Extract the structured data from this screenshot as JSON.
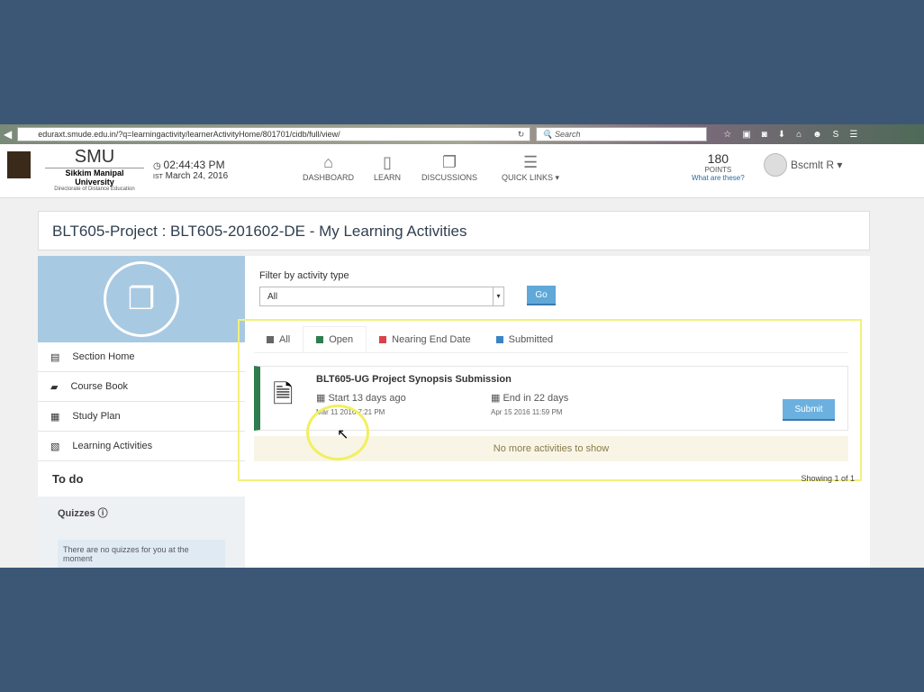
{
  "browser": {
    "url": "eduraxt.smude.edu.in/?q=learningactivity/learnerActivityHome/801701/cidb/full/view/",
    "search_placeholder": "Search"
  },
  "header": {
    "logo_title": "SMU",
    "logo_subtitle": "Sikkim Manipal University",
    "logo_tagline": "Directorate of Distance Education",
    "time": "02:44:43 PM",
    "tz": "IST",
    "date": "March 24, 2016",
    "nav": [
      {
        "label": "DASHBOARD",
        "icon": "home-icon"
      },
      {
        "label": "LEARN",
        "icon": "document-icon"
      },
      {
        "label": "DISCUSSIONS",
        "icon": "chat-icon"
      },
      {
        "label": "QUICK LINKS ▾",
        "icon": "list-icon"
      }
    ],
    "points": "180",
    "points_label": "POINTS",
    "points_link": "What are these?",
    "user": "Bscmlt R ▾"
  },
  "page_title": "BLT605-Project : BLT605-201602-DE - My Learning Activities",
  "sidebar": {
    "items": [
      {
        "label": "Section Home",
        "icon": "section-home-icon"
      },
      {
        "label": "Course Book",
        "icon": "book-icon"
      },
      {
        "label": "Study Plan",
        "icon": "study-plan-icon"
      },
      {
        "label": "Learning Activities",
        "icon": "activities-icon"
      }
    ],
    "todo": "To do",
    "quizzes": "Quizzes",
    "quiz_msg": "There are no quizzes for you at the moment"
  },
  "filter": {
    "label": "Filter by activity type",
    "value": "All",
    "go": "Go"
  },
  "tabs": [
    {
      "label": "All",
      "color": "#666666"
    },
    {
      "label": "Open",
      "color": "#2e7d4f"
    },
    {
      "label": "Nearing End Date",
      "color": "#d9434a"
    },
    {
      "label": "Submitted",
      "color": "#3b84c4"
    }
  ],
  "activity": {
    "title": "BLT605-UG Project Synopsis Submission",
    "start": "Start 13 days ago",
    "start_date": "Mar 11 2016 7:21 PM",
    "end": "End in 22 days",
    "end_date": "Apr 15 2016 11:59 PM",
    "submit": "Submit"
  },
  "no_more": "No more activities to show",
  "showing": "Showing 1 of 1"
}
